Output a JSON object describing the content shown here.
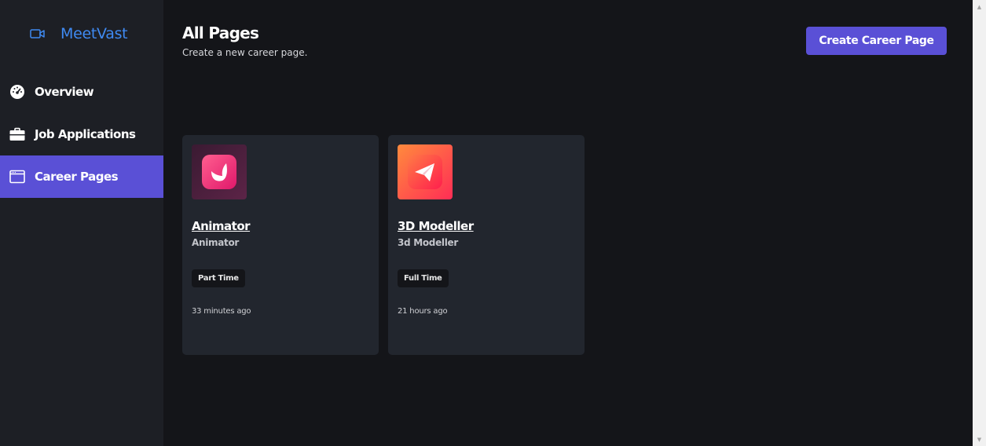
{
  "brand": {
    "name": "MeetVast",
    "icon": "video-camera-icon",
    "color": "#3f8af2"
  },
  "sidebar": {
    "items": [
      {
        "label": "Overview",
        "icon": "dashboard-gauge-icon",
        "active": false
      },
      {
        "label": "Job Applications",
        "icon": "briefcase-icon",
        "active": false
      },
      {
        "label": "Career Pages",
        "icon": "browser-window-icon",
        "active": true
      }
    ]
  },
  "header": {
    "title": "All Pages",
    "subtitle": "Create a new career page.",
    "create_button_label": "Create Career Page"
  },
  "cards": [
    {
      "title": "Animator",
      "subtitle": "Animator",
      "badge": "Part Time",
      "time": "33 minutes ago",
      "logo_icon": "leaf-app-icon"
    },
    {
      "title": "3D Modeller",
      "subtitle": "3d Modeller",
      "badge": "Full Time",
      "time": "21 hours ago",
      "logo_icon": "paper-plane-app-icon"
    }
  ],
  "colors": {
    "accent": "#5a50d6",
    "background": "#141519",
    "sidebar": "#1d1f25",
    "card": "#22262e"
  }
}
